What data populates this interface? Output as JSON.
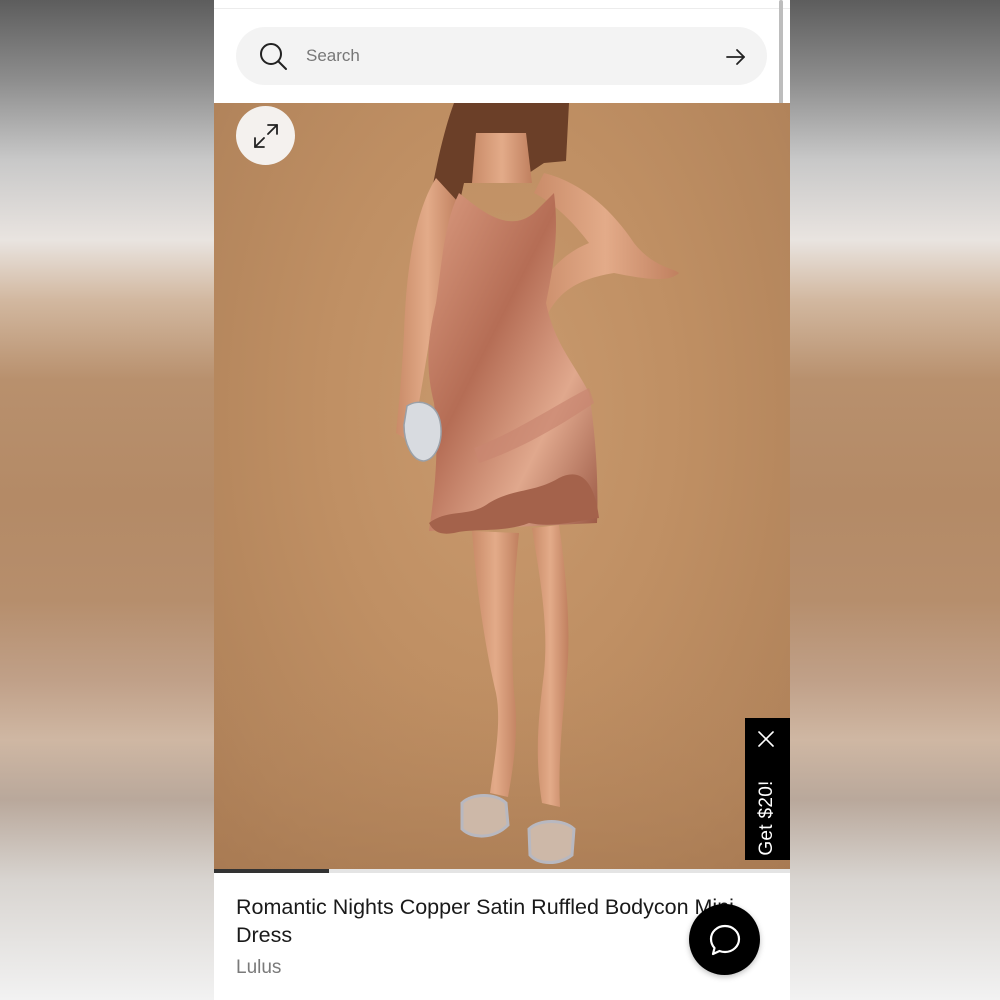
{
  "search": {
    "placeholder": "Search",
    "icon": "search-icon",
    "submit_icon": "arrow-right-icon"
  },
  "gallery": {
    "expand_icon": "expand-icon",
    "image_progress": 0.2,
    "background_color": "#bf8f63"
  },
  "promo": {
    "label": "Get $20!",
    "close_icon": "close-icon",
    "background_color": "#000000"
  },
  "product": {
    "title": "Romantic Nights Copper Satin Ruffled Bodycon Mini Dress",
    "brand": "Lulus"
  },
  "chat": {
    "icon": "chat-bubble-icon",
    "background_color": "#000000"
  }
}
